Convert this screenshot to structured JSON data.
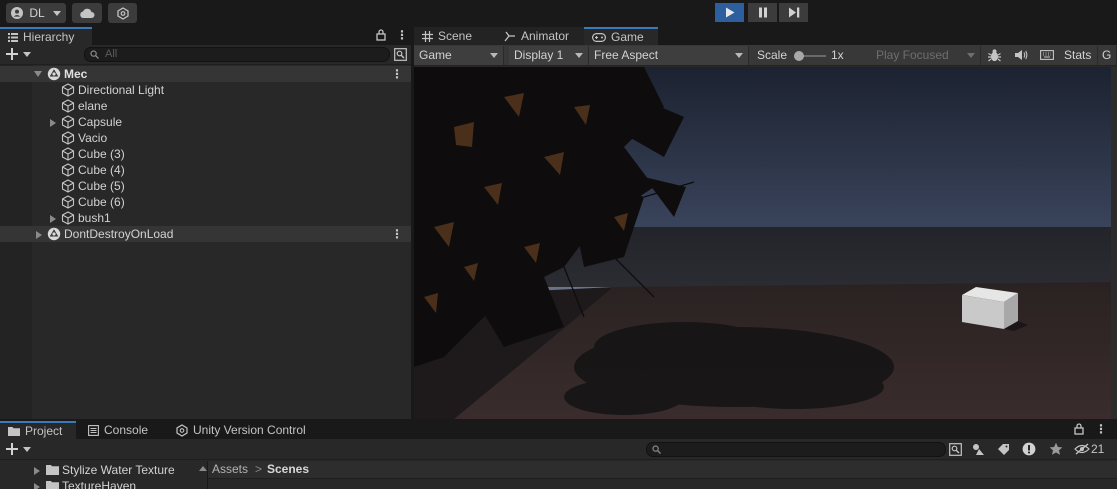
{
  "toolbar": {
    "account_label": "DL",
    "account_icon": "account-circle-icon",
    "cloud_icon": "cloud-icon",
    "collab_icon": "version-control-icon",
    "play_icon": "play-icon",
    "pause_icon": "pause-icon",
    "step_icon": "step-icon",
    "play_active_color": "#2d5e9e"
  },
  "hierarchy": {
    "tab_label": "Hierarchy",
    "search_placeholder": "All",
    "scenes": [
      {
        "name": "Mec",
        "expanded": true,
        "children": [
          {
            "label": "Directional Light",
            "has_children": false
          },
          {
            "label": "elane",
            "has_children": false
          },
          {
            "label": "Capsule",
            "has_children": true
          },
          {
            "label": "Vacio",
            "has_children": false
          },
          {
            "label": "Cube (3)",
            "has_children": false
          },
          {
            "label": "Cube (4)",
            "has_children": false
          },
          {
            "label": "Cube (5)",
            "has_children": false
          },
          {
            "label": "Cube (6)",
            "has_children": false
          },
          {
            "label": "bush1",
            "has_children": true
          }
        ]
      },
      {
        "name": "DontDestroyOnLoad",
        "expanded": false,
        "children": []
      }
    ]
  },
  "game_panel": {
    "tabs": [
      {
        "label": "Scene",
        "icon": "grid-icon",
        "active": false
      },
      {
        "label": "Animator",
        "icon": "animator-icon",
        "active": false
      },
      {
        "label": "Game",
        "icon": "gamepad-icon",
        "active": true
      }
    ],
    "view_mode": "Game",
    "display": "Display 1",
    "aspect": "Free Aspect",
    "scale_label": "Scale",
    "scale_value": "1x",
    "scale_level": 0.0,
    "play_mode": "Play Focused",
    "stats_label": "Stats",
    "gizmos_label": "G"
  },
  "project_panel": {
    "tabs": [
      {
        "label": "Project",
        "icon": "folder-icon",
        "active": true
      },
      {
        "label": "Console",
        "icon": "console-icon",
        "active": false
      },
      {
        "label": "Unity Version Control",
        "icon": "version-control-icon",
        "active": false
      }
    ],
    "tree": [
      {
        "label": "Stylize Water Texture"
      },
      {
        "label": "TextureHaven"
      }
    ],
    "breadcrumb": [
      "Assets",
      "Scenes"
    ],
    "hidden_count": "21"
  }
}
